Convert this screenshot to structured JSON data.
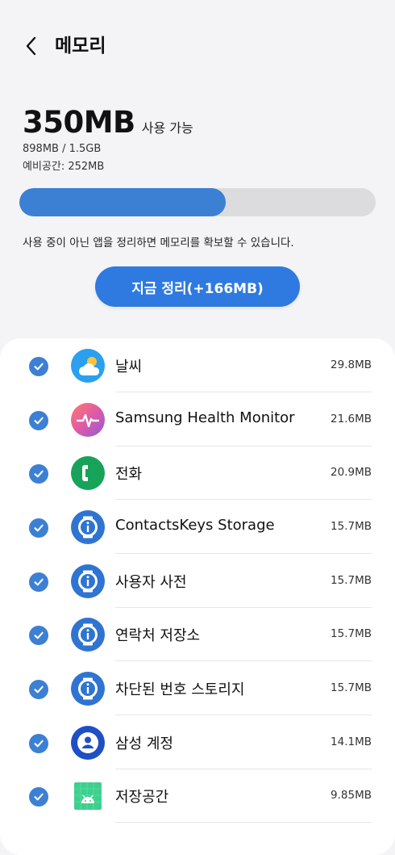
{
  "header": {
    "title": "메모리",
    "back_icon": "chevron-left-icon"
  },
  "summary": {
    "available_value": "350MB",
    "available_label": "사용 가능",
    "used_text": "898MB / 1.5GB",
    "reserved_text": "예비공간: 252MB"
  },
  "usage_bar": {
    "fraction_used": 0.58,
    "fill_color": "#3c80d4",
    "track_color": "#dcdcde"
  },
  "hint": "사용 중이 아닌 앱을 정리하면 메모리를 확보할 수 있습니다.",
  "clean_button": {
    "label": "지금 정리(+166MB)",
    "color": "#2f7ae0"
  },
  "apps": [
    {
      "name": "날씨",
      "size": "29.8MB",
      "icon": "weather-icon",
      "checked": true
    },
    {
      "name": "Samsung Health Monitor",
      "size": "21.6MB",
      "icon": "health-monitor-icon",
      "checked": true
    },
    {
      "name": "전화",
      "size": "20.9MB",
      "icon": "phone-icon",
      "checked": true
    },
    {
      "name": "ContactsKeys Storage",
      "size": "15.7MB",
      "icon": "system-app-icon",
      "checked": true
    },
    {
      "name": "사용자 사전",
      "size": "15.7MB",
      "icon": "system-app-icon",
      "checked": true
    },
    {
      "name": "연락처 저장소",
      "size": "15.7MB",
      "icon": "system-app-icon",
      "checked": true
    },
    {
      "name": "차단된 번호 스토리지",
      "size": "15.7MB",
      "icon": "system-app-icon",
      "checked": true
    },
    {
      "name": "삼성 계정",
      "size": "14.1MB",
      "icon": "samsung-account-icon",
      "checked": true
    },
    {
      "name": "저장공간",
      "size": "9.85MB",
      "icon": "storage-android-icon",
      "checked": true
    }
  ]
}
